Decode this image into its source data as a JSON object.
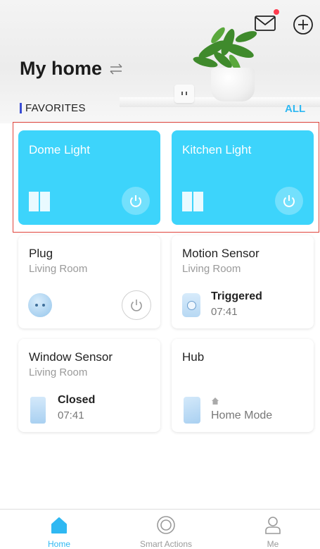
{
  "header": {
    "title": "My home",
    "favorites_label": "FAVORITES",
    "all_label": "ALL"
  },
  "favorites": [
    {
      "name": "Dome Light"
    },
    {
      "name": "Kitchen Light"
    }
  ],
  "devices": {
    "plug": {
      "name": "Plug",
      "room": "Living Room"
    },
    "motion": {
      "name": "Motion Sensor",
      "room": "Living Room",
      "status": "Triggered",
      "time": "07:41"
    },
    "window": {
      "name": "Window Sensor",
      "room": "Living Room",
      "status": "Closed",
      "time": "07:41"
    },
    "hub": {
      "name": "Hub",
      "mode": "Home Mode"
    }
  },
  "nav": {
    "home": "Home",
    "smart_actions": "Smart Actions",
    "me": "Me"
  },
  "colors": {
    "accent": "#2fb8f2",
    "tile_blue": "#3dd4fb",
    "notification": "#ff3b4e",
    "highlight_border": "#e0433b"
  }
}
